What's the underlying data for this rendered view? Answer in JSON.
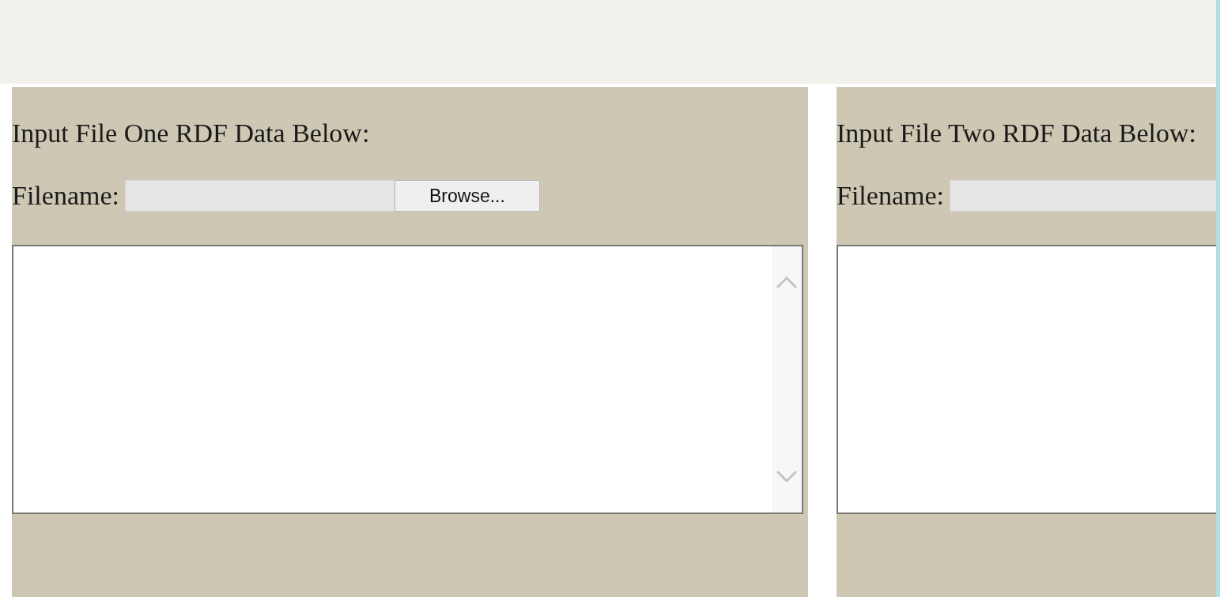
{
  "panels": [
    {
      "heading": "Input File One RDF Data Below:",
      "filename_label": "Filename:",
      "browse_button": "Browse...",
      "scrollbar": true
    },
    {
      "heading": "Input File Two RDF Data Below:",
      "filename_label": "Filename:"
    }
  ]
}
